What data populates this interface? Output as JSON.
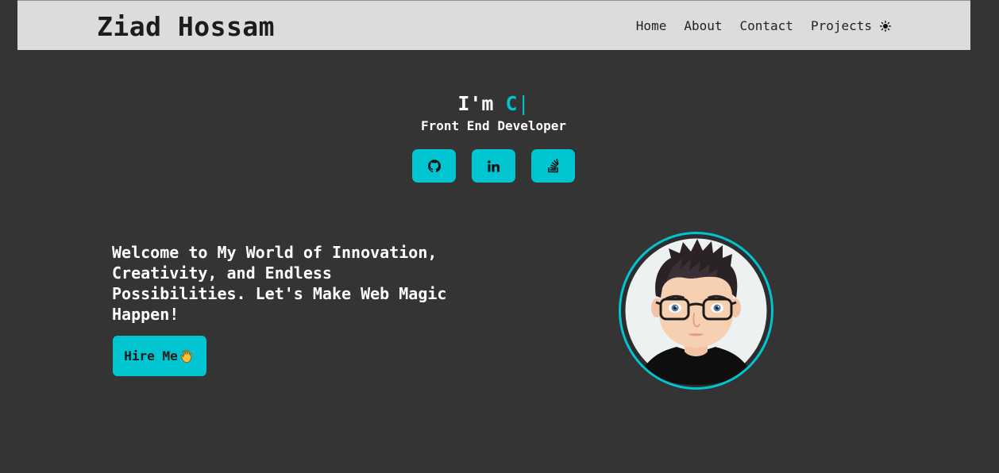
{
  "header": {
    "brand": "Ziad Hossam",
    "nav": [
      "Home",
      "About",
      "Contact",
      "Projects"
    ],
    "theme_icon": "sun-icon"
  },
  "hero": {
    "intro_prefix": "I'm",
    "typed_text": "C",
    "caret": "|",
    "role": "Front End Developer",
    "socials": [
      {
        "icon": "github-icon"
      },
      {
        "icon": "linkedin-icon"
      },
      {
        "icon": "stackoverflow-icon"
      }
    ]
  },
  "about": {
    "welcome": "Welcome to My World of Innovation, Creativity, and Endless Possibilities. Let's Make Web Magic Happen!",
    "hire_label": "Hire Me",
    "hire_icon": "waving-hand-icon"
  },
  "avatar": {
    "icon": "cartoon-avatar"
  },
  "colors": {
    "accent": "#00c4cf",
    "background": "#343434",
    "navbar": "#dcdcdc"
  }
}
